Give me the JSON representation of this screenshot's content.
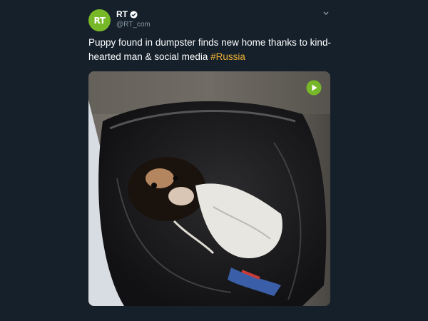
{
  "tweet": {
    "display_name": "RT",
    "handle": "@RT_com",
    "avatar_text": "RT",
    "text": "Puppy found in dumpster finds new home thanks to kind-hearted man & social media ",
    "hashtag": "#Russia"
  },
  "icons": {
    "verified": "verified-badge-icon",
    "menu": "chevron-down-icon",
    "play": "play-icon"
  },
  "colors": {
    "background": "#15202b",
    "avatar": "#77b829",
    "hashtag": "#f2b233",
    "play": "#77b829"
  }
}
